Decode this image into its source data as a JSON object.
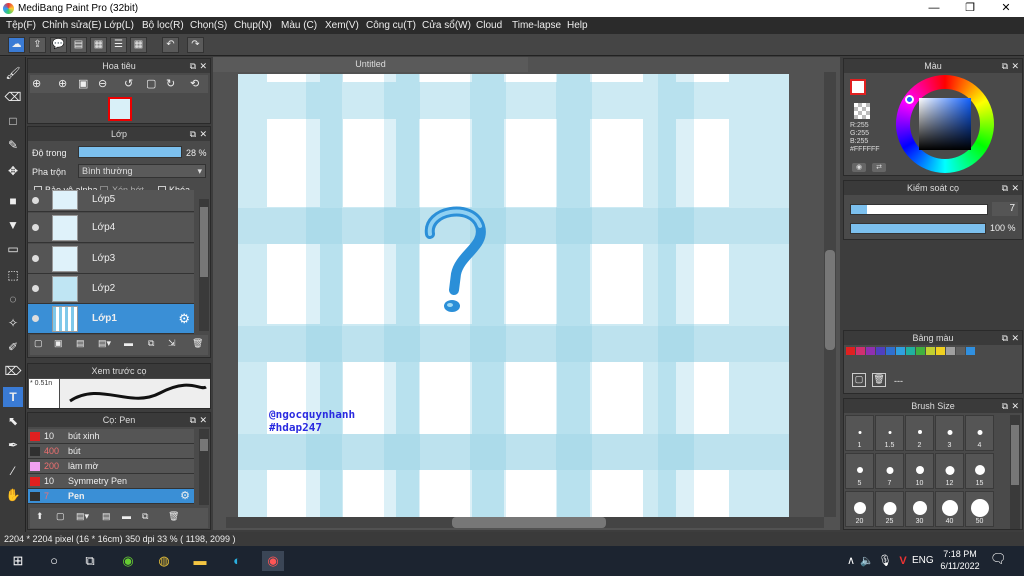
{
  "window": {
    "title": "MediBang Paint Pro (32bit)",
    "minimize": "—",
    "maximize": "❐",
    "close": "✕"
  },
  "menu": [
    "Tệp(F)",
    "Chỉnh sửa(E)",
    "Lớp(L)",
    "Bộ lọc(R)",
    "Chọn(S)",
    "Chụp(N)",
    "Màu (C)",
    "Xem(V)",
    "Công cụ(T)",
    "Cửa sổ(W)",
    "Cloud",
    "Time-lapse",
    "Help"
  ],
  "navigator": {
    "title": "Hoa tiêu"
  },
  "layer_panel": {
    "title": "Lớp",
    "opacity_label": "Độ trong",
    "opacity_value": 28,
    "opacity_text": "28 %",
    "blend_label": "Pha trộn",
    "blend_value": "Bình thường",
    "protect_alpha": "Bảo vệ alpha",
    "clipping": "Xén bớt",
    "lock": "Khóa",
    "layers": [
      {
        "name": "Lớp5"
      },
      {
        "name": "Lớp4"
      },
      {
        "name": "Lớp3"
      },
      {
        "name": "Lớp2"
      },
      {
        "name": "Lớp1",
        "selected": true
      }
    ]
  },
  "brush_preview": {
    "title": "Xem trước cọ",
    "size": "0.51n"
  },
  "brush_list": {
    "title": "Cọ: Pen",
    "items": [
      {
        "size": "10",
        "name": "bút xinh",
        "color": "#e02020"
      },
      {
        "size": "400",
        "name": "bút",
        "color": "#303030"
      },
      {
        "size": "200",
        "name": "làm mờ",
        "color": "#f0a0f0"
      },
      {
        "size": "10",
        "name": "Symmetry Pen",
        "color": "#e02020"
      },
      {
        "size": "7",
        "name": "Pen",
        "color": "#303030",
        "selected": true
      }
    ]
  },
  "canvas": {
    "tab": "Untitled",
    "watermark_line1": "@ngocquynhanh",
    "watermark_line2": "#hdap247"
  },
  "color_panel": {
    "title": "Màu",
    "r": "R:255",
    "g": "G:255",
    "b": "B:255",
    "hex": "#FFFFFF"
  },
  "brush_control": {
    "title": "Kiểm soát cọ",
    "size": "7",
    "opacity": "100 %",
    "opacity_fraction": 1.0
  },
  "palette": {
    "title": "Bảng màu",
    "label": "---",
    "colors": [
      "#e02020",
      "#d03070",
      "#9030b0",
      "#5040c0",
      "#3070d0",
      "#30a0e0",
      "#20b0a0",
      "#40b040",
      "#c0d030",
      "#f0d020",
      "#a0a0a0",
      "#606060",
      "#3090e0"
    ]
  },
  "brush_size": {
    "title": "Brush Size",
    "sizes": [
      "1",
      "1.5",
      "2",
      "3",
      "4",
      "5",
      "7",
      "10",
      "12",
      "15",
      "20",
      "25",
      "30",
      "40",
      "50"
    ]
  },
  "status": "2204 * 2204 pixel   (16 * 16cm)   350 dpi   33 %   ( 1198, 2099 )",
  "taskbar": {
    "lang": "ENG",
    "time": "7:18 PM",
    "date": "6/11/2022"
  }
}
